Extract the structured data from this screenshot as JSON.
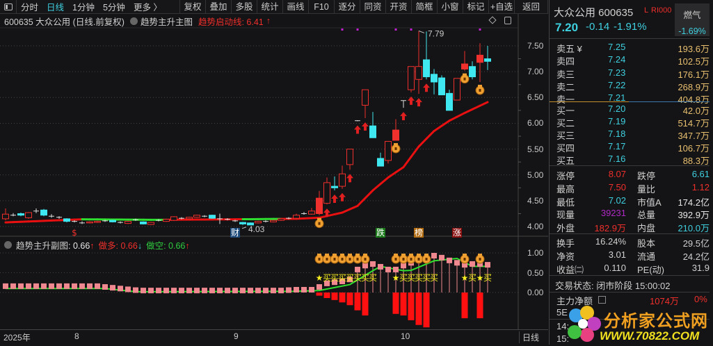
{
  "toolbar": {
    "left": [
      "分时",
      "日线",
      "1分钟",
      "5分钟",
      "更多 〉"
    ],
    "active": "日线",
    "buttons": [
      "复权",
      "叠加",
      "多股",
      "统计",
      "画线",
      "F10",
      "逐分",
      "同资",
      "开资",
      "简框",
      "小窗",
      "标记",
      "+自选",
      "返回"
    ]
  },
  "info": {
    "title": "600635 大众公用 (日线.前复权)",
    "indicator": "趋势主升主图",
    "line_label": "趋势启动线: 6.41",
    "arrow": "↑"
  },
  "sub": {
    "indicator": "趋势主升副图",
    "value": ": 0.66",
    "v_arrow": "↑",
    "long_label": "做多: 0.66",
    "long_arrow": "↓",
    "short_label": "做空: 0.66",
    "short_arrow": "↑"
  },
  "date_axis": [
    "2025年",
    "8",
    "9",
    "10"
  ],
  "period": "日线",
  "colors": {
    "up": "#f0302c",
    "down": "#3fe8f0",
    "ma_up": "#e81010",
    "ma_flat": "#30e030",
    "pink": "#f08890",
    "bag": "#f0a030",
    "star": "#f8f020"
  },
  "chart_data": {
    "type": "candlestick",
    "price_ticks": [
      "7.50",
      "7.00",
      "6.50",
      "6.00",
      "5.50",
      "5.00",
      "4.50",
      "4.00"
    ],
    "price_range": [
      3.95,
      7.85
    ],
    "sub_ticks": [
      "1.00",
      "0.50",
      "0.00"
    ],
    "candles": [
      [
        4.15,
        4.24,
        4.35,
        4.12,
        "h"
      ],
      [
        4.22,
        4.22,
        4.26,
        4.2,
        "x"
      ],
      [
        4.25,
        4.22,
        4.27,
        4.2,
        "c"
      ],
      [
        4.17,
        4.27,
        4.28,
        4.15,
        "h"
      ],
      [
        4.3,
        4.3,
        4.35,
        4.26,
        "x"
      ],
      [
        4.32,
        4.22,
        4.34,
        4.2,
        "c"
      ],
      [
        4.2,
        4.2,
        4.24,
        4.17,
        "x"
      ],
      [
        4.18,
        4.18,
        4.2,
        4.15,
        "x"
      ],
      [
        4.15,
        4.1,
        4.16,
        4.08,
        "c"
      ],
      [
        4.1,
        4.1,
        4.12,
        4.08,
        "x"
      ],
      [
        4.07,
        4.07,
        4.1,
        4.05,
        "x"
      ],
      [
        4.07,
        4.09,
        4.1,
        4.06,
        "h"
      ],
      [
        4.08,
        4.1,
        4.11,
        4.07,
        "h"
      ],
      [
        4.11,
        4.11,
        4.13,
        4.09,
        "x"
      ],
      [
        4.12,
        4.09,
        4.13,
        4.08,
        "c"
      ],
      [
        4.08,
        4.08,
        4.1,
        4.06,
        "x"
      ],
      [
        4.06,
        4.1,
        4.11,
        4.05,
        "h"
      ],
      [
        4.13,
        4.13,
        4.15,
        4.11,
        "x"
      ],
      [
        4.09,
        4.05,
        4.1,
        4.04,
        "c"
      ],
      [
        4.04,
        4.08,
        4.09,
        4.03,
        "h"
      ],
      [
        4.12,
        4.12,
        4.14,
        4.1,
        "x"
      ],
      [
        4.1,
        4.14,
        4.15,
        4.09,
        "h"
      ],
      [
        4.12,
        4.19,
        4.2,
        4.11,
        "h"
      ],
      [
        4.16,
        4.16,
        4.18,
        4.14,
        "x"
      ],
      [
        4.15,
        4.18,
        4.19,
        4.14,
        "h"
      ],
      [
        4.18,
        4.22,
        4.23,
        4.17,
        "h"
      ],
      [
        4.2,
        4.2,
        4.22,
        4.18,
        "x"
      ],
      [
        4.22,
        4.16,
        4.23,
        4.15,
        "c"
      ],
      [
        4.15,
        4.15,
        4.25,
        4.05,
        "x"
      ],
      [
        4.14,
        4.14,
        4.16,
        4.12,
        "x"
      ],
      [
        4.11,
        4.11,
        4.13,
        4.09,
        "x"
      ],
      [
        4.08,
        4.05,
        4.09,
        4.03,
        "c"
      ],
      [
        4.07,
        4.03,
        4.08,
        4.03,
        "c"
      ],
      [
        4.07,
        4.1,
        4.11,
        4.06,
        "h"
      ],
      [
        4.1,
        4.1,
        4.12,
        4.08,
        "x"
      ],
      [
        4.09,
        4.12,
        4.13,
        4.08,
        "h"
      ],
      [
        4.12,
        4.15,
        4.16,
        4.11,
        "h"
      ],
      [
        4.16,
        4.16,
        4.18,
        4.14,
        "x"
      ],
      [
        4.16,
        4.22,
        4.25,
        4.15,
        "h"
      ],
      [
        4.25,
        4.25,
        4.28,
        4.23,
        "x"
      ],
      [
        4.24,
        4.3,
        4.36,
        4.23,
        "h"
      ],
      [
        4.25,
        4.55,
        4.69,
        4.22,
        "f"
      ],
      [
        4.45,
        4.85,
        4.95,
        4.43,
        "h"
      ],
      [
        4.78,
        4.75,
        4.97,
        4.7,
        "c"
      ],
      [
        4.78,
        5.02,
        5.18,
        4.73,
        "h"
      ],
      [
        5.2,
        5.5,
        5.5,
        5.1,
        "h"
      ],
      [
        6.05,
        6.05,
        6.06,
        6.04,
        "x"
      ],
      [
        6.35,
        6.65,
        6.65,
        6.1,
        "h"
      ],
      [
        5.95,
        5.72,
        6.22,
        5.72,
        "c"
      ],
      [
        5.32,
        5.17,
        5.43,
        5.17,
        "c"
      ],
      [
        5.28,
        5.65,
        5.65,
        5.22,
        "h"
      ],
      [
        5.67,
        5.87,
        6.08,
        5.67,
        "f"
      ],
      [
        6.44,
        6.44,
        6.44,
        6.3,
        "x"
      ],
      [
        6.65,
        7.1,
        7.1,
        6.6,
        "h"
      ],
      [
        6.85,
        7.1,
        7.79,
        6.57,
        "h"
      ],
      [
        7.23,
        6.9,
        7.78,
        6.85,
        "c"
      ],
      [
        6.95,
        6.8,
        7.05,
        6.56,
        "c"
      ],
      [
        6.88,
        6.55,
        6.93,
        6.55,
        "c"
      ],
      [
        6.58,
        6.25,
        6.65,
        6.25,
        "c"
      ],
      [
        6.45,
        6.87,
        6.87,
        6.45,
        "h"
      ],
      [
        7.05,
        7.15,
        7.4,
        7.02,
        "f"
      ],
      [
        7.1,
        6.9,
        7.2,
        6.85,
        "c"
      ],
      [
        7.18,
        7.32,
        7.55,
        6.8,
        "f"
      ],
      [
        7.25,
        7.2,
        7.5,
        7.03,
        "c"
      ]
    ],
    "trend_line": [
      [
        0,
        4.08
      ],
      [
        5,
        4.11
      ],
      [
        10,
        4.14
      ],
      [
        20,
        4.13
      ],
      [
        30,
        4.14
      ],
      [
        38,
        4.15
      ],
      [
        41,
        4.17
      ],
      [
        44,
        4.27
      ],
      [
        46,
        4.4
      ],
      [
        48,
        4.7
      ],
      [
        50,
        4.95
      ],
      [
        52,
        5.15
      ],
      [
        54,
        5.55
      ],
      [
        56,
        5.85
      ],
      [
        58,
        6.05
      ],
      [
        60,
        6.2
      ],
      [
        63,
        6.41
      ]
    ],
    "trend_flat_ranges": [
      [
        10,
        21
      ],
      [
        31,
        36
      ]
    ],
    "high_label": "7.79",
    "high_index": 54,
    "low_label": "4.03",
    "low_index": 32,
    "up_arrow_indices": [
      42,
      43,
      44,
      45,
      46,
      47,
      52,
      53,
      54,
      55
    ],
    "bag_indices": [
      41,
      51,
      60,
      62
    ],
    "top_dot_indices": [
      44,
      46,
      51,
      53,
      62
    ],
    "events": [
      {
        "i": 9,
        "text": "$",
        "color": "#f0302c",
        "bg": "transparent"
      },
      {
        "i": 30,
        "text": "财",
        "color": "#ffffff",
        "bg": "#1c4a7a"
      },
      {
        "i": 49,
        "text": "跌",
        "color": "#ffffff",
        "bg": "#1a7a1a"
      },
      {
        "i": 54,
        "text": "榜",
        "color": "#ffffff",
        "bg": "#b06a10"
      },
      {
        "i": 59,
        "text": "涨",
        "color": "#ffffff",
        "bg": "#8a1010"
      }
    ],
    "sub_values": [
      0.16,
      0.16,
      0.16,
      0.16,
      0.16,
      0.16,
      0.16,
      0.16,
      0.16,
      0.16,
      0.16,
      0.16,
      0.16,
      0.14,
      0.12,
      0.1,
      0.08,
      0.06,
      0.05,
      0.05,
      0.05,
      0.05,
      0.05,
      0.05,
      0.05,
      0.05,
      0.05,
      0.05,
      0.05,
      0.05,
      0.05,
      0.05,
      0.05,
      0.05,
      0.05,
      0.05,
      0.05,
      0.06,
      0.07,
      0.07,
      0.07,
      0.14,
      0.23,
      0.26,
      0.28,
      0.33,
      0.58,
      0.68,
      0.72,
      0.65,
      0.58,
      0.58,
      0.68,
      0.75,
      0.86,
      0.86,
      0.93,
      0.88,
      0.81,
      0.75,
      0.7,
      0.72,
      0.72,
      0.7
    ],
    "sub_line": [
      [
        0,
        0.1
      ],
      [
        13,
        0.1
      ],
      [
        17,
        0.02
      ],
      [
        38,
        0.03
      ],
      [
        41,
        0.05
      ],
      [
        45,
        0.2
      ],
      [
        48,
        0.55
      ],
      [
        49,
        0.66
      ],
      [
        52,
        0.55
      ],
      [
        53,
        0.56
      ],
      [
        56,
        0.8
      ],
      [
        59,
        0.86
      ],
      [
        61,
        0.66
      ],
      [
        63,
        0.66
      ]
    ],
    "sub_bars": [
      [
        41,
        -0.08
      ],
      [
        42,
        -0.14
      ],
      [
        43,
        -0.19
      ],
      [
        44,
        -0.25
      ],
      [
        45,
        -0.32
      ],
      [
        46,
        -0.45
      ],
      [
        47,
        -0.58
      ],
      [
        51,
        -0.54
      ],
      [
        52,
        -0.58
      ],
      [
        53,
        -0.7
      ],
      [
        54,
        -0.82
      ],
      [
        55,
        -0.88
      ],
      [
        60,
        -0.65
      ],
      [
        62,
        -0.65
      ]
    ],
    "sub_bags": [
      41,
      42,
      43,
      44,
      45,
      46,
      47,
      51,
      52,
      53,
      54,
      55,
      60,
      62
    ],
    "sub_signals": [
      {
        "i": 41,
        "t": "★"
      },
      {
        "i": 42,
        "t": "买"
      },
      {
        "i": 43,
        "t": "买"
      },
      {
        "i": 44,
        "t": "买"
      },
      {
        "i": 45,
        "t": "买"
      },
      {
        "i": 46,
        "t": "买"
      },
      {
        "i": 47,
        "t": "买"
      },
      {
        "i": 48,
        "t": "买"
      },
      {
        "i": 51,
        "t": "★"
      },
      {
        "i": 52,
        "t": "买"
      },
      {
        "i": 53,
        "t": "买"
      },
      {
        "i": 54,
        "t": "买"
      },
      {
        "i": 55,
        "t": "买"
      },
      {
        "i": 56,
        "t": "买"
      },
      {
        "i": 60,
        "t": "★"
      },
      {
        "i": 61,
        "t": "买"
      },
      {
        "i": 62,
        "t": "★"
      },
      {
        "i": 63,
        "t": "买"
      }
    ]
  },
  "quote": {
    "name": "大众公用 600635",
    "tag_l": "L",
    "tag_r": "RI000",
    "price": "7.20",
    "change": "-0.14",
    "pct": "-1.91%",
    "sector": "燃气",
    "sector_pct": "-1.69%"
  },
  "asks": [
    {
      "label": "卖五 ¥",
      "price": "7.25",
      "vol": "193.6万"
    },
    {
      "label": "卖四",
      "price": "7.24",
      "vol": "102.5万"
    },
    {
      "label": "卖三",
      "price": "7.23",
      "vol": "176.1万"
    },
    {
      "label": "卖二",
      "price": "7.22",
      "vol": "268.9万"
    },
    {
      "label": "卖一",
      "price": "7.21",
      "vol": "404.8万"
    }
  ],
  "bids": [
    {
      "label": "买一",
      "price": "7.20",
      "vol": "42.0万"
    },
    {
      "label": "买二",
      "price": "7.19",
      "vol": "514.7万"
    },
    {
      "label": "买三",
      "price": "7.18",
      "vol": "347.7万"
    },
    {
      "label": "买四",
      "price": "7.17",
      "vol": "106.7万"
    },
    {
      "label": "买五",
      "price": "7.16",
      "vol": "88.3万"
    }
  ],
  "stats": [
    {
      "l1": "涨停",
      "v1": "8.07",
      "c1": "red",
      "l2": "跌停",
      "v2": "6.61",
      "c2": "cyan"
    },
    {
      "l1": "最高",
      "v1": "7.50",
      "c1": "red",
      "l2": "量比",
      "v2": "1.12",
      "c2": "red"
    },
    {
      "l1": "最低",
      "v1": "7.02",
      "c1": "cyan",
      "l2": "市值A",
      "v2": "174.2亿",
      "c2": "white"
    },
    {
      "l1": "现量",
      "v1": "39231",
      "c1": "purple",
      "l2": "总量",
      "v2": "392.9万",
      "c2": "white"
    },
    {
      "l1": "外盘",
      "v1": "182.9万",
      "c1": "red",
      "l2": "内盘",
      "v2": "210.0万",
      "c2": "cyan"
    }
  ],
  "stats2": [
    {
      "l1": "换手",
      "v1": "16.24%",
      "l2": "股本",
      "v2": "29.5亿"
    },
    {
      "l1": "净资",
      "v1": "3.01",
      "l2": "流通",
      "v2": "24.2亿"
    },
    {
      "l1": "收益㈡",
      "v1": "0.110",
      "l2": "PE(动)",
      "v2": "31.9"
    }
  ],
  "trade_status": "交易状态: 闭市阶段 15:00:02",
  "main_flow": {
    "label": "主力净额",
    "value": "1074万",
    "pct": "0%"
  },
  "partial_rows": [
    "5E",
    "14:",
    "15:"
  ],
  "watermark": {
    "title": "分析家公式网",
    "url": "WWW.70822.COM"
  }
}
